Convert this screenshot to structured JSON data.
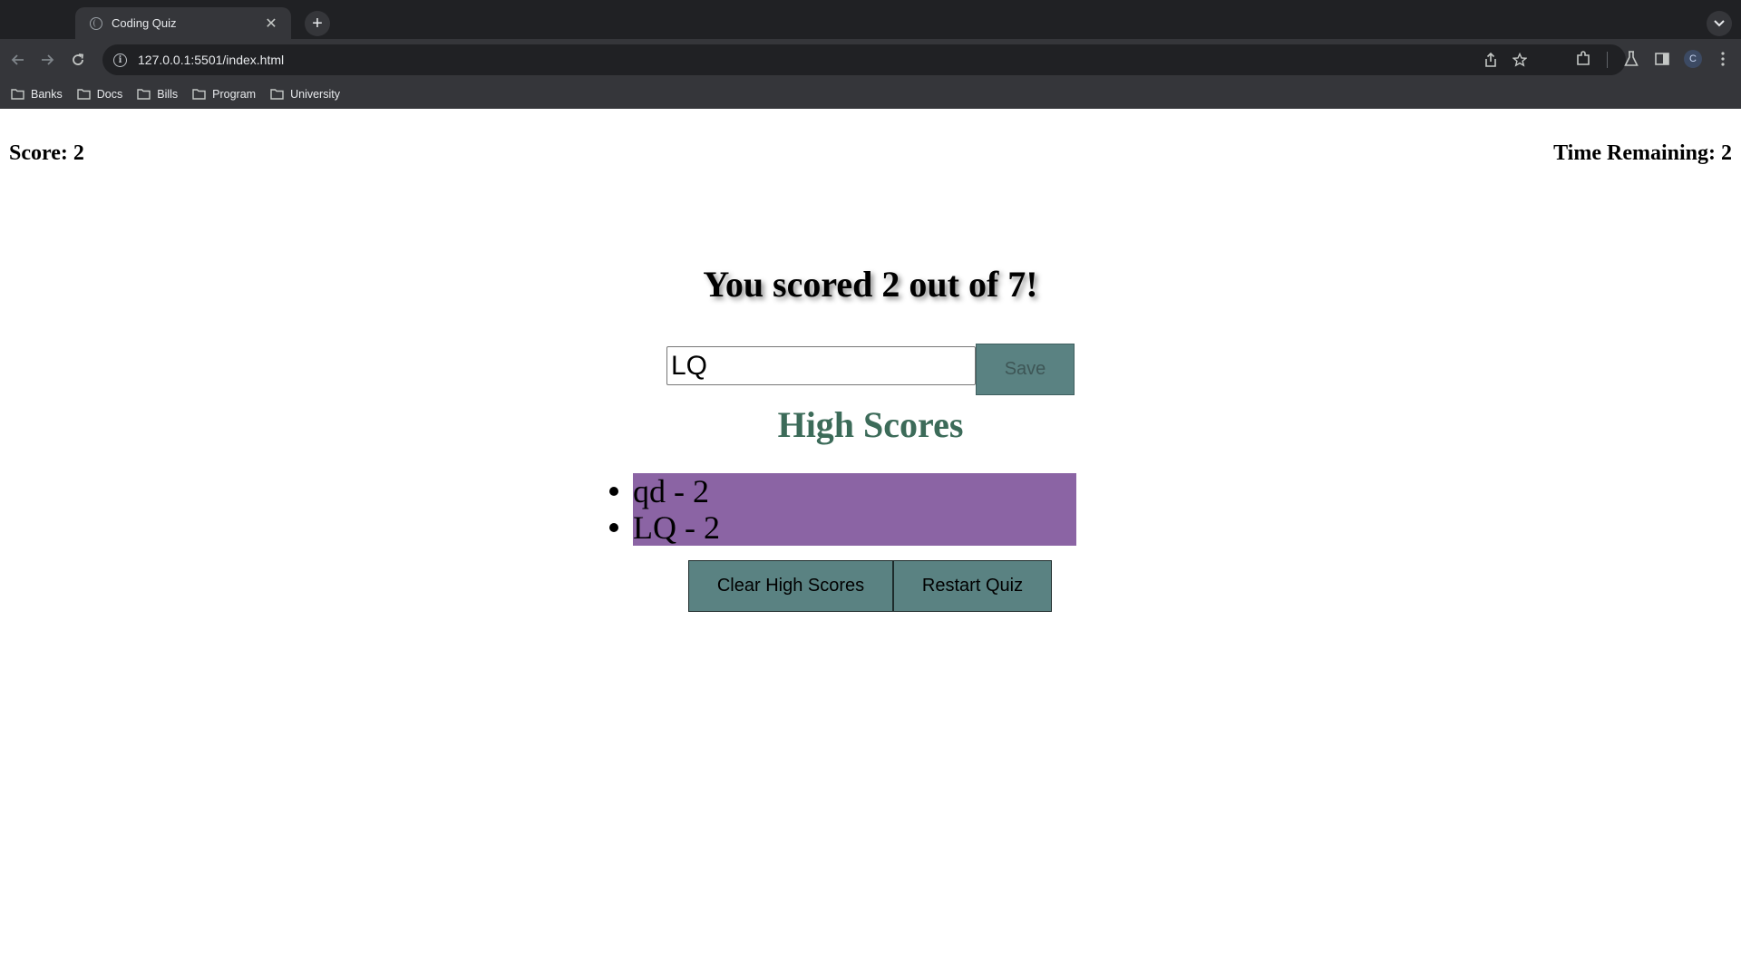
{
  "browser": {
    "tab_title": "Coding Quiz",
    "tab_close": "✕",
    "new_tab": "+",
    "url": "127.0.0.1:5501/index.html",
    "info_glyph": "i",
    "profile_initial": "C",
    "bookmarks": [
      "Banks",
      "Docs",
      "Bills",
      "Program",
      "University"
    ]
  },
  "quiz": {
    "score_label": "Score: 2",
    "time_label": "Time Remaining: 2",
    "result_text": "You scored 2 out of 7!",
    "initials_value": "LQ",
    "save_label": "Save",
    "high_scores_title": "High Scores",
    "high_scores": [
      "qd - 2",
      "LQ - 2"
    ],
    "clear_label": "Clear High Scores",
    "restart_label": "Restart Quiz"
  },
  "colors": {
    "button_bg": "#5a8282",
    "list_bg": "#8b64a4",
    "high_scores_title": "#3c6b59"
  }
}
